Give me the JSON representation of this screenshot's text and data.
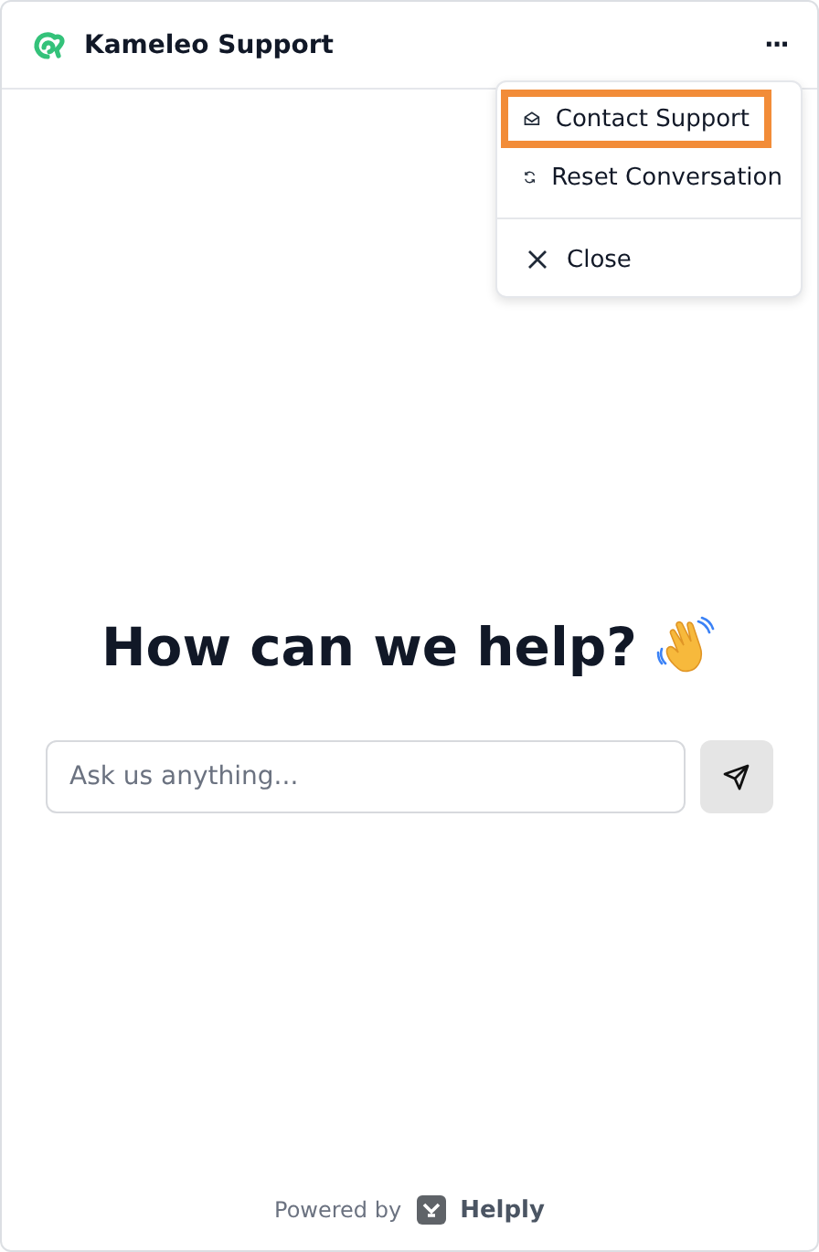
{
  "header": {
    "title": "Kameleo Support",
    "menu_button": "···"
  },
  "menu": {
    "open": true,
    "items": [
      {
        "kind": "mail",
        "label": "Contact Support",
        "highlighted": true
      },
      {
        "kind": "reset",
        "label": "Reset Conversation",
        "highlighted": false
      },
      {
        "kind": "close",
        "label": "Close",
        "highlighted": false
      }
    ]
  },
  "heading": "How can we help?",
  "search": {
    "placeholder": "Ask us anything..."
  },
  "footer": {
    "prefix": "Powered by",
    "brand": "Helply"
  }
}
